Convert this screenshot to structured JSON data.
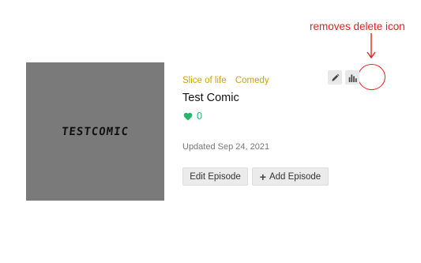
{
  "annotation": {
    "text": "removes delete icon",
    "color": "#e32222"
  },
  "thumbnail": {
    "title": "TESTCOMIC",
    "background": "#7a7a7a"
  },
  "comic": {
    "genres": [
      "Slice of life",
      "Comedy"
    ],
    "title": "Test Comic",
    "likes": "0",
    "updated": "Updated Sep 24, 2021"
  },
  "actions": {
    "edit_episode": "Edit Episode",
    "add_episode": "Add Episode",
    "edit_icon": "pencil-icon",
    "stats_icon": "bar-chart-icon"
  },
  "colors": {
    "genre": "#c8a600",
    "like": "#22b86b"
  }
}
